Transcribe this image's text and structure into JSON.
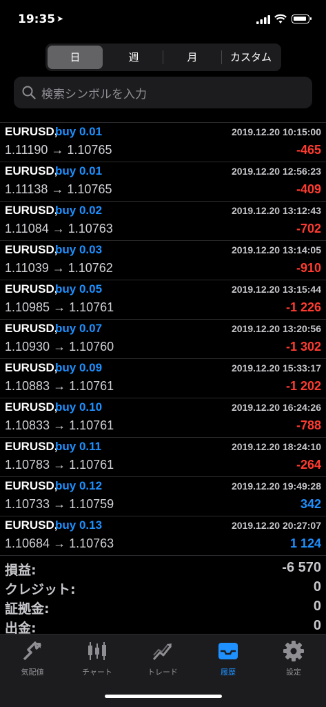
{
  "status": {
    "time": "19:35",
    "location_icon": "location-arrow-icon"
  },
  "segments": [
    "日",
    "週",
    "月",
    "カスタム"
  ],
  "search": {
    "placeholder": "検索シンボルを入力"
  },
  "trades": [
    {
      "symbol": "EURUSD,",
      "type": "buy 0.01",
      "datetime": "2019.12.20 10:15:00",
      "prices": "1.11190 → 1.10765",
      "profit": "-465",
      "profit_sign": "neg"
    },
    {
      "symbol": "EURUSD,",
      "type": "buy 0.01",
      "datetime": "2019.12.20 12:56:23",
      "prices": "1.11138 → 1.10765",
      "profit": "-409",
      "profit_sign": "neg"
    },
    {
      "symbol": "EURUSD,",
      "type": "buy 0.02",
      "datetime": "2019.12.20 13:12:43",
      "prices": "1.11084 → 1.10763",
      "profit": "-702",
      "profit_sign": "neg"
    },
    {
      "symbol": "EURUSD,",
      "type": "buy 0.03",
      "datetime": "2019.12.20 13:14:05",
      "prices": "1.11039 → 1.10762",
      "profit": "-910",
      "profit_sign": "neg"
    },
    {
      "symbol": "EURUSD,",
      "type": "buy 0.05",
      "datetime": "2019.12.20 13:15:44",
      "prices": "1.10985 → 1.10761",
      "profit": "-1 226",
      "profit_sign": "neg"
    },
    {
      "symbol": "EURUSD,",
      "type": "buy 0.07",
      "datetime": "2019.12.20 13:20:56",
      "prices": "1.10930 → 1.10760",
      "profit": "-1 302",
      "profit_sign": "neg"
    },
    {
      "symbol": "EURUSD,",
      "type": "buy 0.09",
      "datetime": "2019.12.20 15:33:17",
      "prices": "1.10883 → 1.10761",
      "profit": "-1 202",
      "profit_sign": "neg"
    },
    {
      "symbol": "EURUSD,",
      "type": "buy 0.10",
      "datetime": "2019.12.20 16:24:26",
      "prices": "1.10833 → 1.10761",
      "profit": "-788",
      "profit_sign": "neg"
    },
    {
      "symbol": "EURUSD,",
      "type": "buy 0.11",
      "datetime": "2019.12.20 18:24:10",
      "prices": "1.10783 → 1.10761",
      "profit": "-264",
      "profit_sign": "neg"
    },
    {
      "symbol": "EURUSD,",
      "type": "buy 0.12",
      "datetime": "2019.12.20 19:49:28",
      "prices": "1.10733 → 1.10759",
      "profit": "342",
      "profit_sign": "pos"
    },
    {
      "symbol": "EURUSD,",
      "type": "buy 0.13",
      "datetime": "2019.12.20 20:27:07",
      "prices": "1.10684 → 1.10763",
      "profit": "1 124",
      "profit_sign": "pos"
    }
  ],
  "summary": [
    {
      "label": "損益:",
      "value": "-6 570"
    },
    {
      "label": "クレジット:",
      "value": "0"
    },
    {
      "label": "証拠金:",
      "value": "0"
    },
    {
      "label": "出金:",
      "value": "0"
    }
  ],
  "tabs": [
    {
      "label": "気配値",
      "icon": "quotes-icon"
    },
    {
      "label": "チャート",
      "icon": "candlestick-chart-icon"
    },
    {
      "label": "トレード",
      "icon": "trade-trend-icon"
    },
    {
      "label": "履歴",
      "icon": "history-inbox-icon",
      "active": true
    },
    {
      "label": "設定",
      "icon": "gear-icon"
    }
  ],
  "colors": {
    "negative": "#ff3b30",
    "positive": "#1e90ff",
    "accent": "#1e90ff"
  }
}
